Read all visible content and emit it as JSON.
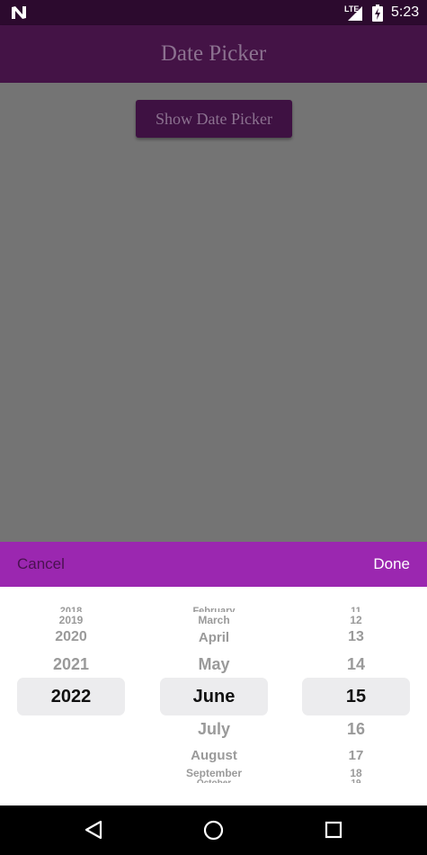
{
  "status_bar": {
    "network_label": "LTE",
    "time": "5:23",
    "icons": [
      "n-logo-icon",
      "signal-icon",
      "battery-icon"
    ]
  },
  "app_bar": {
    "title": "Date Picker"
  },
  "main": {
    "show_button_label": "Show Date Picker"
  },
  "picker": {
    "cancel_label": "Cancel",
    "done_label": "Done",
    "toolbar_color": "#9b27b0",
    "years": [
      "2018",
      "2019",
      "2020",
      "2021",
      "2022"
    ],
    "selected_year": "2022",
    "months_above": [
      "February",
      "March",
      "April",
      "May"
    ],
    "selected_month": "June",
    "months_below": [
      "July",
      "August",
      "September",
      "October"
    ],
    "days_above": [
      "11",
      "12",
      "13",
      "14"
    ],
    "selected_day": "15",
    "days_below": [
      "16",
      "17",
      "18",
      "19"
    ]
  },
  "nav_bar": {
    "icons": [
      "back-icon",
      "home-icon",
      "recents-icon"
    ]
  }
}
